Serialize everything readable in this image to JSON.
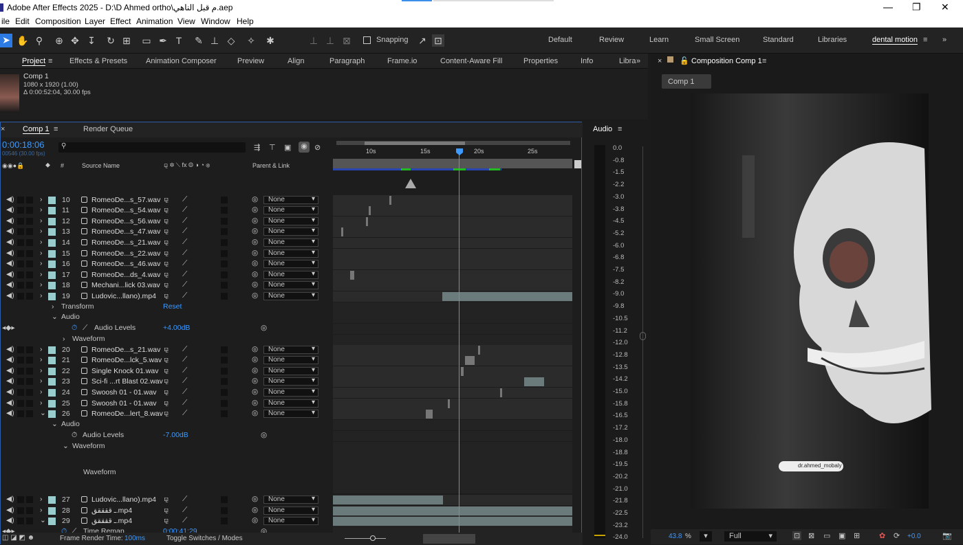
{
  "window": {
    "title": "Adobe After Effects 2025 - D:\\D Ahmed ortho\\م قبل الناهي.aep"
  },
  "menu": [
    "ile",
    "Edit",
    "Composition",
    "Layer",
    "Effect",
    "Animation",
    "View",
    "Window",
    "Help"
  ],
  "toolbar": {
    "snapping": "Snapping"
  },
  "workspaces": [
    "Default",
    "Review",
    "Learn",
    "Small Screen",
    "Standard",
    "Libraries",
    "dental motion"
  ],
  "panels": {
    "tabs": [
      "Project",
      "Effects & Presets",
      "Animation Composer",
      "Preview",
      "Align",
      "Paragraph",
      "Frame.io",
      "Content-Aware Fill",
      "Properties",
      "Info",
      "Libra"
    ]
  },
  "project": {
    "comp_name": "Comp 1",
    "resolution": "1080 x 1920 (1.00)",
    "duration": "Δ 0:00:52:04, 30.00 fps"
  },
  "timeline": {
    "tab": "Comp 1",
    "tab2": "Render Queue",
    "timecode": "0:00:18:06",
    "frames": "00546 (30.00 fps)",
    "col_source": "Source Name",
    "col_num": "#",
    "col_parent": "Parent & Link",
    "ruler": [
      "10s",
      "15s",
      "20s",
      "25s"
    ],
    "footer_label": "Frame Render Time:",
    "footer_value": "100ms",
    "toggle": "Toggle Switches / Modes"
  },
  "layers": [
    {
      "num": "10",
      "name": "RomeoDe...s_57.wav",
      "parent": "None"
    },
    {
      "num": "11",
      "name": "RomeoDe...s_54.wav",
      "parent": "None"
    },
    {
      "num": "12",
      "name": "RomeoDe...s_56.wav",
      "parent": "None"
    },
    {
      "num": "13",
      "name": "RomeoDe...s_47.wav",
      "parent": "None"
    },
    {
      "num": "14",
      "name": "RomeoDe...s_21.wav",
      "parent": "None"
    },
    {
      "num": "15",
      "name": "RomeoDe...s_22.wav",
      "parent": "None"
    },
    {
      "num": "16",
      "name": "RomeoDe...s_46.wav",
      "parent": "None"
    },
    {
      "num": "17",
      "name": "RomeoDe...ds_4.wav",
      "parent": "None"
    },
    {
      "num": "18",
      "name": "Mechani...lick 03.wav",
      "parent": "None"
    },
    {
      "num": "19",
      "name": "Ludovic...llano).mp4",
      "parent": "None"
    },
    {
      "num": "20",
      "name": "RomeoDe...s_21.wav",
      "parent": "None"
    },
    {
      "num": "21",
      "name": "RomeoDe...lck_5.wav",
      "parent": "None"
    },
    {
      "num": "22",
      "name": "Single Knock 01.wav",
      "parent": "None"
    },
    {
      "num": "23",
      "name": "Sci-fi ...rt Blast 02.wav",
      "parent": "None"
    },
    {
      "num": "24",
      "name": "Swoosh 01 - 01.wav",
      "parent": "None"
    },
    {
      "num": "25",
      "name": "Swoosh 01 - 01.wav",
      "parent": "None"
    },
    {
      "num": "26",
      "name": "RomeoDe...lert_8.wav",
      "parent": "None"
    },
    {
      "num": "27",
      "name": "Ludovic...llano).mp4",
      "parent": "None"
    },
    {
      "num": "28",
      "name": "ـ ققققق.mp4",
      "parent": "None"
    },
    {
      "num": "29",
      "name": "ـ ققققق.mp4",
      "parent": "None"
    }
  ],
  "props": {
    "transform": "Transform",
    "reset": "Reset",
    "audio": "Audio",
    "audio_levels": "Audio Levels",
    "level19": "+4.00dB",
    "waveform": "Waveform",
    "level26": "-7.00dB",
    "time_remap": "Time Remap",
    "time_remap_val": "0:00:41:29"
  },
  "audio_panel": {
    "title": "Audio",
    "levels": [
      "0.0",
      "-0.8",
      "-1.5",
      "-2.2",
      "-3.0",
      "-3.8",
      "-4.5",
      "-5.2",
      "-6.0",
      "-6.8",
      "-7.5",
      "-8.2",
      "-9.0",
      "-9.8",
      "-10.5",
      "-11.2",
      "-12.0",
      "-12.8",
      "-13.5",
      "-14.2",
      "-15.0",
      "-15.8",
      "-16.5",
      "-17.2",
      "-18.0",
      "-18.8",
      "-19.5",
      "-20.2",
      "-21.0",
      "-21.8",
      "-22.5",
      "-23.2",
      "-24.0"
    ]
  },
  "viewer": {
    "title": "Composition Comp 1",
    "comp_tab": "Comp 1",
    "zoom": "43.8",
    "zoom_unit": "%",
    "quality": "Full",
    "exposure": "+0.0",
    "watermark": "dr.ahmed_mobaly"
  }
}
